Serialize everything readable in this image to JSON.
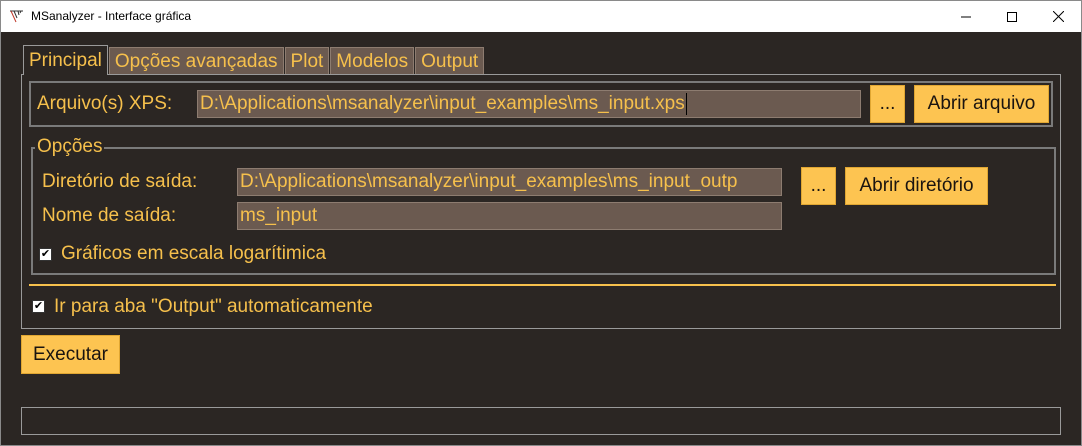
{
  "window": {
    "title": "MSanalyzer - Interface gráfica",
    "minimize_glyph": "—",
    "maximize_glyph": "☐",
    "close_glyph": "✕"
  },
  "colors": {
    "background": "#2b2623",
    "accent_text": "#f6c04c",
    "field_bg": "#6b5a50",
    "button_bg": "#fdc451"
  },
  "tabs": [
    {
      "label": "Principal",
      "active": true
    },
    {
      "label": "Opções avançadas",
      "active": false
    },
    {
      "label": "Plot",
      "active": false
    },
    {
      "label": "Modelos",
      "active": false
    },
    {
      "label": "Output",
      "active": false
    }
  ],
  "xps": {
    "label": "Arquivo(s) XPS:",
    "value": "D:\\Applications\\msanalyzer\\input_examples\\ms_input.xps",
    "browse_label": "...",
    "open_label": "Abrir arquivo"
  },
  "options": {
    "legend": "Opções",
    "output_dir_label": "Diretório de saída:",
    "output_dir_value": "D:\\Applications\\msanalyzer\\input_examples\\ms_input_outp",
    "browse_label": "...",
    "open_dir_label": "Abrir diretório",
    "output_name_label": "Nome de saída:",
    "output_name_value": "ms_input",
    "log_scale_label": "Gráficos em escala logarítimica",
    "log_scale_checked": true
  },
  "auto_output": {
    "label": "Ir para aba \"Output\" automaticamente",
    "checked": true
  },
  "execute_label": "Executar",
  "progress": {
    "value": 0
  }
}
